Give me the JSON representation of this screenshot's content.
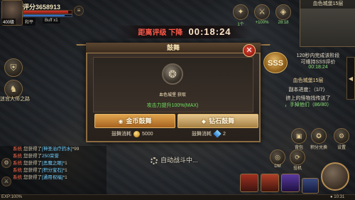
{
  "player": {
    "score_label": "评分3658913",
    "level_tag": "400级",
    "tags": [
      "和平",
      "Buff x1"
    ]
  },
  "timer": {
    "label": "距离评级 下降",
    "value": "00:18:24"
  },
  "top_icons": [
    {
      "icon": "wing-icon",
      "label": "1个"
    },
    {
      "icon": "sword-icon",
      "label": "+100%"
    },
    {
      "icon": "shop-icon",
      "label": "28:18"
    }
  ],
  "minimap": {
    "title": "血色城堡15层"
  },
  "quest": {
    "sss": "SSS",
    "line1": "120秒内完成该阶段",
    "line2": "可维持SSS评价",
    "time": "00:18:24",
    "title": "血色城堡15层",
    "progress": "副本进度：（1/7）",
    "desc1": "挤上的怪物找传送了",
    "desc2": "，手掉他们（86/80）"
  },
  "left": {
    "items": [
      {
        "icon": "shield-icon",
        "label": "迷宫大师之路"
      }
    ]
  },
  "dialog": {
    "title": "鼓舞",
    "emblem_caption": "血色城堡 获取",
    "stat": "攻击力提升100%(MAX)",
    "gold_button": "金币鼓舞",
    "diamond_button": "钻石鼓舞",
    "gold_cost_label": "鼓舞消耗",
    "gold_cost_value": "5000",
    "diamond_cost_label": "鼓舞消耗",
    "diamond_cost_value": "2",
    "close": "✕"
  },
  "auto_battle": "自动战斗中...",
  "chat": [
    {
      "tag": "系统",
      "text": "您获得了",
      "item": "[神圣治疗药水]",
      "extra": "*99"
    },
    {
      "tag": "系统",
      "text": "您获得了",
      "item": "250荣誉",
      "extra": ""
    },
    {
      "tag": "系统",
      "text": "您获得了",
      "item": "[恶魔之眼]",
      "extra": "*1"
    },
    {
      "tag": "系统",
      "text": "您获得了",
      "item": "[积分宝石]",
      "extra": "*1"
    },
    {
      "tag": "系统",
      "text": "您获得了",
      "item": "[通用祝福]",
      "extra": "*1"
    }
  ],
  "exp": "EXP:100%",
  "bottom_right": "● 10:31",
  "skills": {
    "round": [
      {
        "label": "背包"
      },
      {
        "label": "积分兑换"
      },
      {
        "label": "DM"
      },
      {
        "label": "挂机"
      },
      {
        "label": "设置"
      }
    ]
  }
}
